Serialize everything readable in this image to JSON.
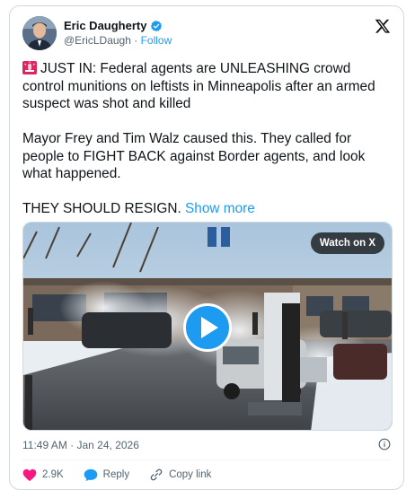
{
  "author": {
    "name": "Eric Daugherty",
    "handle": "@EricLDaugh",
    "separator": "·",
    "follow_label": "Follow"
  },
  "tweet": {
    "paragraphs": [
      "JUST IN: Federal agents are UNLEASHING crowd control munitions on leftists in Minneapolis after an armed suspect was shot and killed",
      "Mayor Frey and Tim Walz caused this. They called for people to FIGHT BACK against Border agents, and look what happened.",
      "THEY SHOULD RESIGN."
    ],
    "show_more": "Show more",
    "siren_emoji": "siren-icon"
  },
  "media": {
    "watch_label": "Watch on X"
  },
  "meta": {
    "time": "11:49 AM",
    "separator": "·",
    "date": "Jan 24, 2026"
  },
  "actions": {
    "like_count": "2.9K",
    "reply_label": "Reply",
    "copy_link_label": "Copy link"
  },
  "colors": {
    "accent": "#1d9bf0",
    "like": "#f91880",
    "text": "#0f1419",
    "muted": "#536471"
  }
}
